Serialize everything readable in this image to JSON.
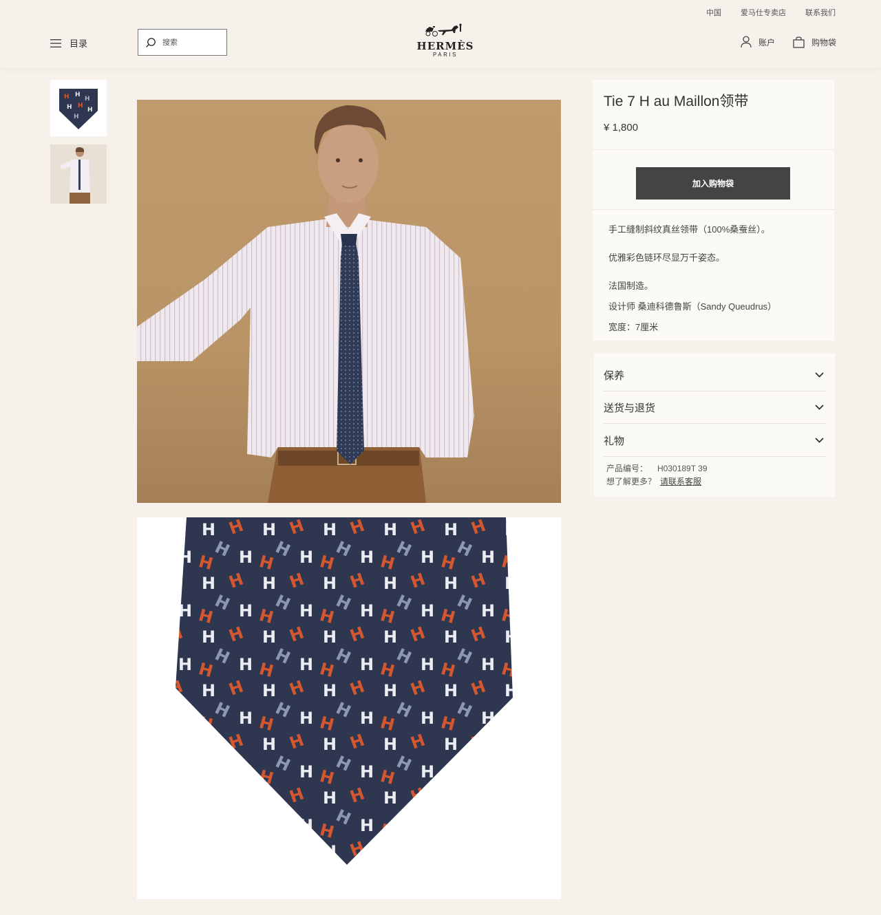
{
  "utility": [
    "中国",
    "爱马仕专卖店",
    "联系我们"
  ],
  "header": {
    "menu_label": "目录",
    "search_placeholder": "搜索",
    "logo": {
      "brand": "HERMÈS",
      "city": "PARIS"
    },
    "account_label": "账户",
    "bag_label": "购物袋"
  },
  "product": {
    "title": "Tie 7 H au Maillon领带",
    "price": "¥ 1,800",
    "add_to_bag": "加入购物袋",
    "description": [
      "手工缝制斜纹真丝领带（100%桑蚕丝）。",
      "优雅彩色链环尽显万千姿态。",
      "法国制造。",
      "设计师 桑迪科德鲁斯（Sandy Queudrus）",
      "宽度：7厘米"
    ]
  },
  "accordion": [
    "保养",
    "送货与退货",
    "礼物"
  ],
  "reference": {
    "label": "产品编号：",
    "value": "H030189T 39",
    "question": "想了解更多？",
    "link": "请联系客服"
  },
  "colors": {
    "background": "#f6f1eb",
    "card": "#fcfaf6",
    "button": "#444444",
    "tie_navy": "#2e3650",
    "tie_orange": "#d4572f",
    "photo_bg": "#bf9a6c"
  }
}
